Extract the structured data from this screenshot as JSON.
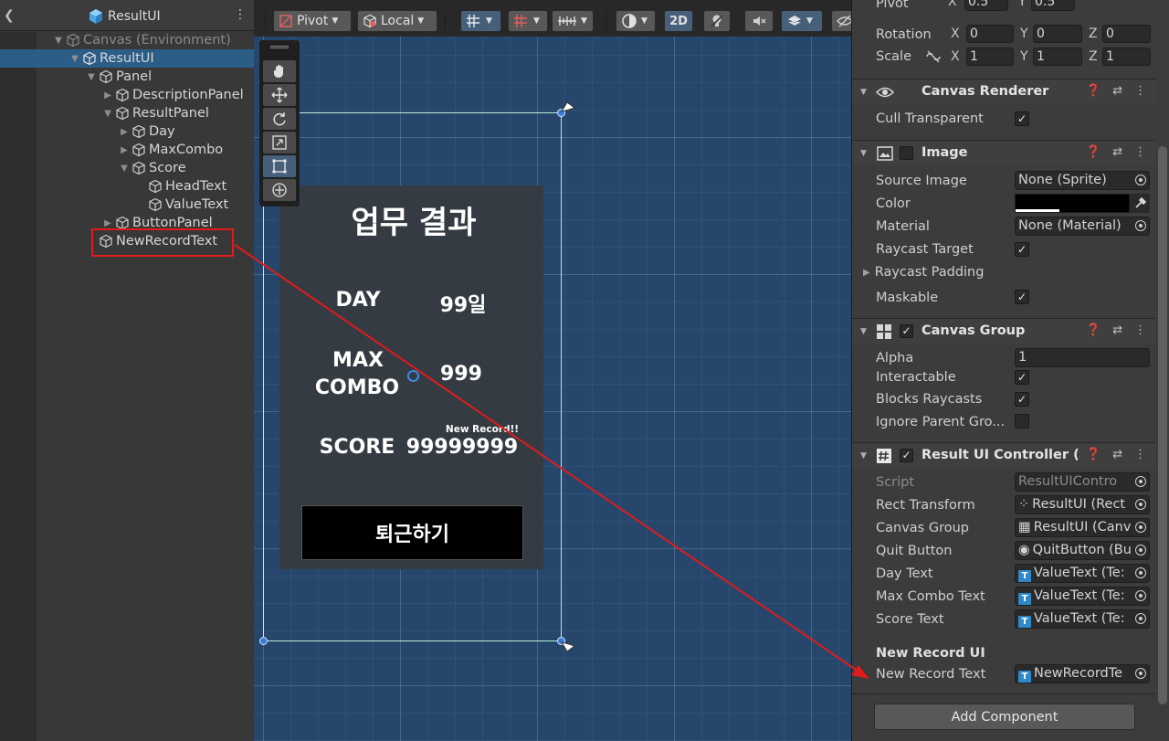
{
  "hierarchy": {
    "title": "ResultUI",
    "items": [
      {
        "label": "Canvas (Environment)",
        "arrow": "▼",
        "dim": true
      },
      {
        "label": "ResultUI",
        "arrow": "▼"
      },
      {
        "label": "Panel",
        "arrow": "▼"
      },
      {
        "label": "DescriptionPanel",
        "arrow": "▶"
      },
      {
        "label": "ResultPanel",
        "arrow": "▼"
      },
      {
        "label": "Day",
        "arrow": "▶"
      },
      {
        "label": "MaxCombo",
        "arrow": "▶"
      },
      {
        "label": "Score",
        "arrow": "▼"
      },
      {
        "label": "HeadText",
        "arrow": ""
      },
      {
        "label": "ValueText",
        "arrow": ""
      },
      {
        "label": "ButtonPanel",
        "arrow": "▶"
      },
      {
        "label": "NewRecordText",
        "arrow": ""
      }
    ]
  },
  "scene_toolbar": {
    "pivot": "Pivot",
    "local": "Local",
    "mode_2d": "2D"
  },
  "scene_ui": {
    "title": "업무 결과",
    "day_label": "DAY",
    "day_value": "99일",
    "combo_label_1": "MAX",
    "combo_label_2": "COMBO",
    "combo_value": "999",
    "new_record": "New Record!!",
    "score_label": "SCORE",
    "score_value": "99999999",
    "quit_button": "퇴근하기"
  },
  "inspector": {
    "transform": {
      "pivot_label": "Pivot",
      "pivot_x": "0.5",
      "pivot_y": "0.5",
      "rotation_label": "Rotation",
      "rot_x": "0",
      "rot_y": "0",
      "rot_z": "0",
      "scale_label": "Scale",
      "scale_x": "1",
      "scale_y": "1",
      "scale_z": "1",
      "axis_x": "X",
      "axis_y": "Y",
      "axis_z": "Z"
    },
    "canvas_renderer": {
      "title": "Canvas Renderer",
      "cull_label": "Cull Transparent Mes"
    },
    "image": {
      "title": "Image",
      "source_label": "Source Image",
      "source_value": "None (Sprite)",
      "color_label": "Color",
      "color_value": "#000000",
      "material_label": "Material",
      "material_value": "None (Material)",
      "raycast_target_label": "Raycast Target",
      "raycast_padding_label": "Raycast Padding",
      "maskable_label": "Maskable"
    },
    "canvas_group": {
      "title": "Canvas Group",
      "alpha_label": "Alpha",
      "alpha_value": "1",
      "interactable_label": "Interactable",
      "blocks_label": "Blocks Raycasts",
      "ignore_label": "Ignore Parent Gro..."
    },
    "controller": {
      "title": "Result UI Controller (Sci",
      "script_label": "Script",
      "script_value": "ResultUIContro",
      "rect_label": "Rect Transform",
      "rect_value": "ResultUI (Rect",
      "cgroup_label": "Canvas Group",
      "cgroup_value": "ResultUI (Canv",
      "quit_label": "Quit Button",
      "quit_value": "QuitButton (Bu",
      "day_label": "Day Text",
      "day_value": "ValueText (Te:",
      "combo_label": "Max Combo Text",
      "combo_value": "ValueText (Te:",
      "score_label": "Score Text",
      "score_value": "ValueText (Te:",
      "section_header": "New Record UI",
      "newrec_label": "New Record Text",
      "newrec_value": "NewRecordTe"
    },
    "add_component": "Add Component"
  },
  "colors": {
    "selection": "#2c5d87",
    "annotation_red": "#e11b1b",
    "scene_bg": "#26476b"
  }
}
